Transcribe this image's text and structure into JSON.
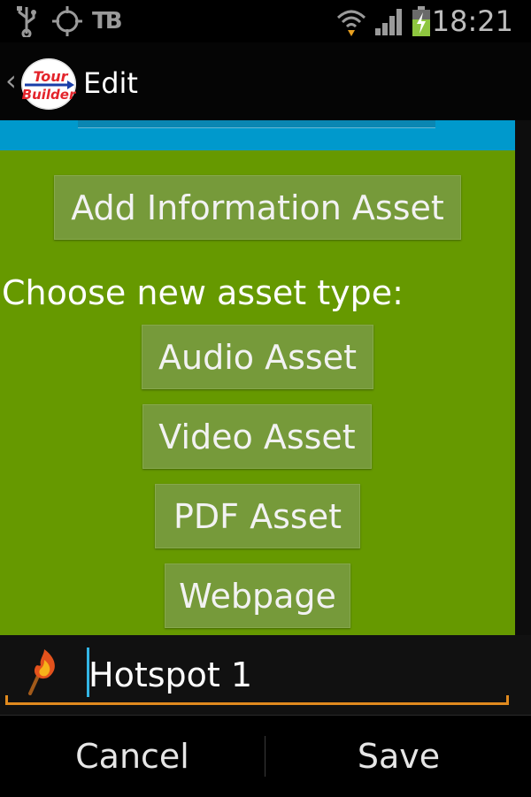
{
  "statusbar": {
    "time": "18:21",
    "icons": [
      "usb-icon",
      "gps-icon",
      "tb-icon",
      "wifi-icon",
      "signal-icon",
      "battery-charging-icon"
    ],
    "tb_text": "TB"
  },
  "actionbar": {
    "title": "Edit",
    "logo_text_top": "Tour",
    "logo_text_bottom": "Builder"
  },
  "colors": {
    "accent_blue": "#0099cc",
    "panel_green": "#669900",
    "button_green": "#769a3a",
    "underline_orange": "#e08a1e",
    "cursor_blue": "#33b5e5"
  },
  "main": {
    "add_info_label": "Add Information Asset",
    "choose_label": "Choose new asset type:",
    "asset_types": [
      "Audio Asset",
      "Video Asset",
      "PDF Asset",
      "Webpage"
    ]
  },
  "hotspot": {
    "name_value": "Hotspot 1",
    "icon": "torch-icon"
  },
  "footer": {
    "cancel_label": "Cancel",
    "save_label": "Save"
  }
}
